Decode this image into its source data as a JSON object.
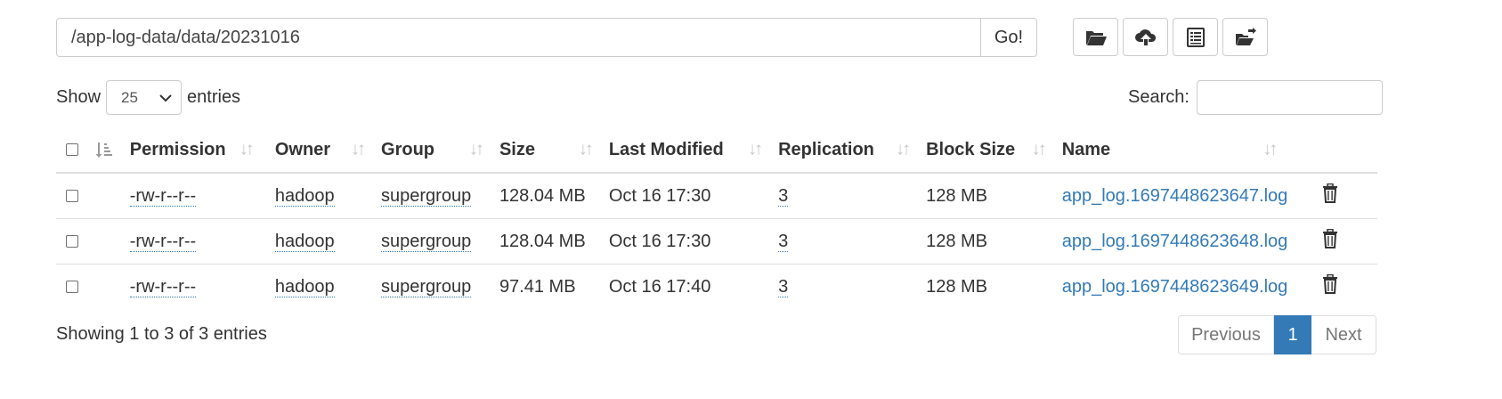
{
  "path_bar": {
    "value": "/app-log-data/data/20231016",
    "go_label": "Go!"
  },
  "toolbar": {
    "buttons": [
      {
        "name": "create-directory",
        "icon": "folder-open-icon"
      },
      {
        "name": "upload",
        "icon": "cloud-upload-icon"
      },
      {
        "name": "cut-paste",
        "icon": "list-alt-icon"
      },
      {
        "name": "move",
        "icon": "folder-move-icon"
      }
    ]
  },
  "length_control": {
    "prefix": "Show",
    "selected": "25",
    "suffix": "entries"
  },
  "search": {
    "label": "Search:",
    "value": ""
  },
  "table": {
    "headers": [
      "Permission",
      "Owner",
      "Group",
      "Size",
      "Last Modified",
      "Replication",
      "Block Size",
      "Name"
    ],
    "rows": [
      {
        "permission": "-rw-r--r--",
        "owner": "hadoop",
        "group": "supergroup",
        "size": "128.04 MB",
        "modified": "Oct 16 17:30",
        "replication": "3",
        "block_size": "128 MB",
        "name": "app_log.1697448623647.log"
      },
      {
        "permission": "-rw-r--r--",
        "owner": "hadoop",
        "group": "supergroup",
        "size": "128.04 MB",
        "modified": "Oct 16 17:30",
        "replication": "3",
        "block_size": "128 MB",
        "name": "app_log.1697448623648.log"
      },
      {
        "permission": "-rw-r--r--",
        "owner": "hadoop",
        "group": "supergroup",
        "size": "97.41 MB",
        "modified": "Oct 16 17:40",
        "replication": "3",
        "block_size": "128 MB",
        "name": "app_log.1697448623649.log"
      }
    ]
  },
  "footer": {
    "info": "Showing 1 to 3 of 3 entries",
    "pagination": {
      "previous": "Previous",
      "current": "1",
      "next": "Next"
    }
  },
  "colors": {
    "link": "#337ab7",
    "border": "#dddddd",
    "active_page": "#337ab7"
  }
}
